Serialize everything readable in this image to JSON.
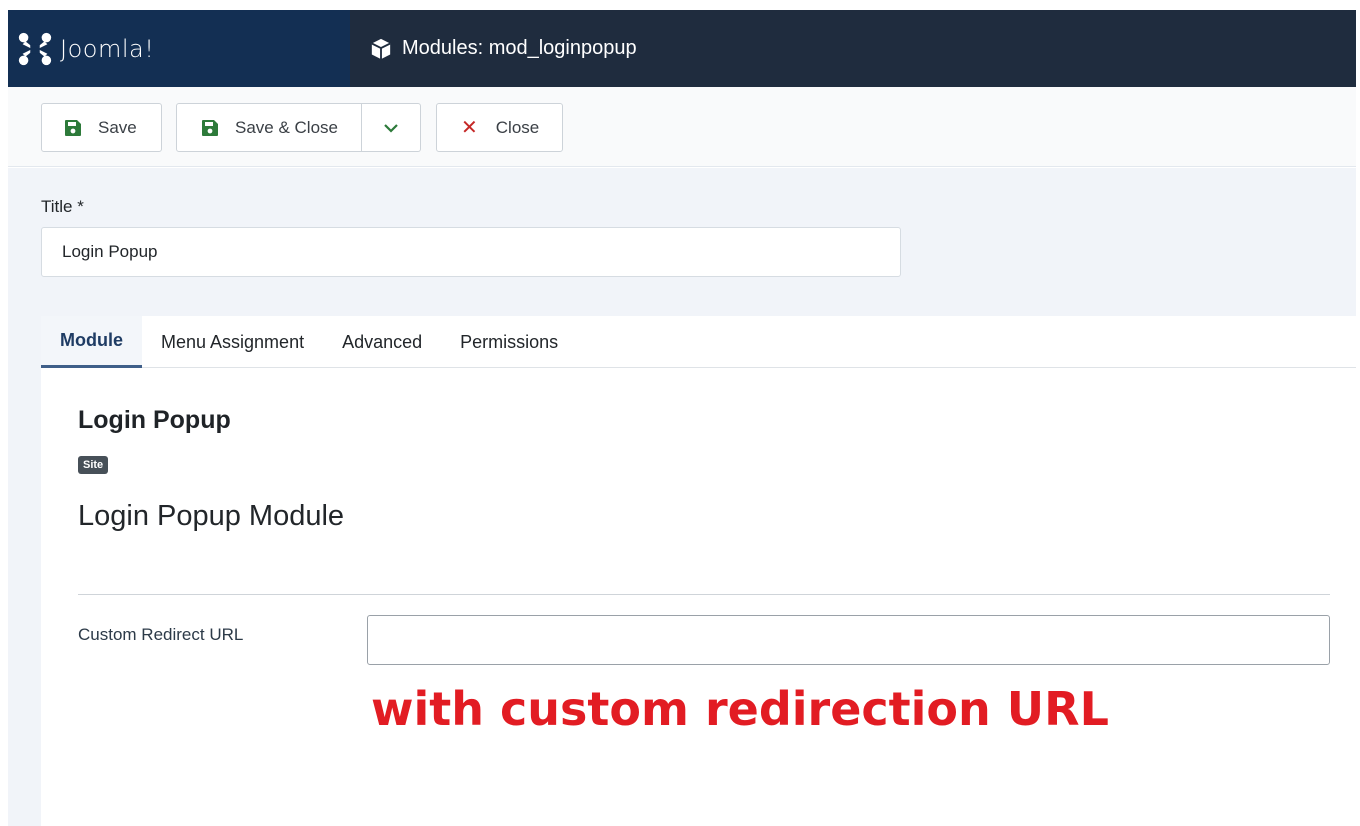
{
  "header": {
    "brand": "Joomla!",
    "page_title": "Modules: mod_loginpopup",
    "icons": {
      "logo": "joomla-logo",
      "page": "cube-icon"
    }
  },
  "toolbar": {
    "save_label": "Save",
    "save_close_label": "Save & Close",
    "close_label": "Close",
    "icons": {
      "save": "floppy-disk-icon",
      "dropdown": "chevron-down-icon",
      "close": "close-icon"
    },
    "colors": {
      "save_icon": "#2d7a3a",
      "close_icon": "#c52827"
    }
  },
  "form": {
    "title_label": "Title *",
    "title_value": "Login Popup"
  },
  "tabs": [
    {
      "label": "Module",
      "active": true
    },
    {
      "label": "Menu Assignment",
      "active": false
    },
    {
      "label": "Advanced",
      "active": false
    },
    {
      "label": "Permissions",
      "active": false
    }
  ],
  "module": {
    "name": "Login Popup",
    "badge": "Site",
    "description": "Login Popup Module",
    "custom_redirect_label": "Custom Redirect URL",
    "custom_redirect_value": ""
  },
  "annotation": {
    "text": "with custom redirection URL",
    "color": "#e21c23"
  }
}
